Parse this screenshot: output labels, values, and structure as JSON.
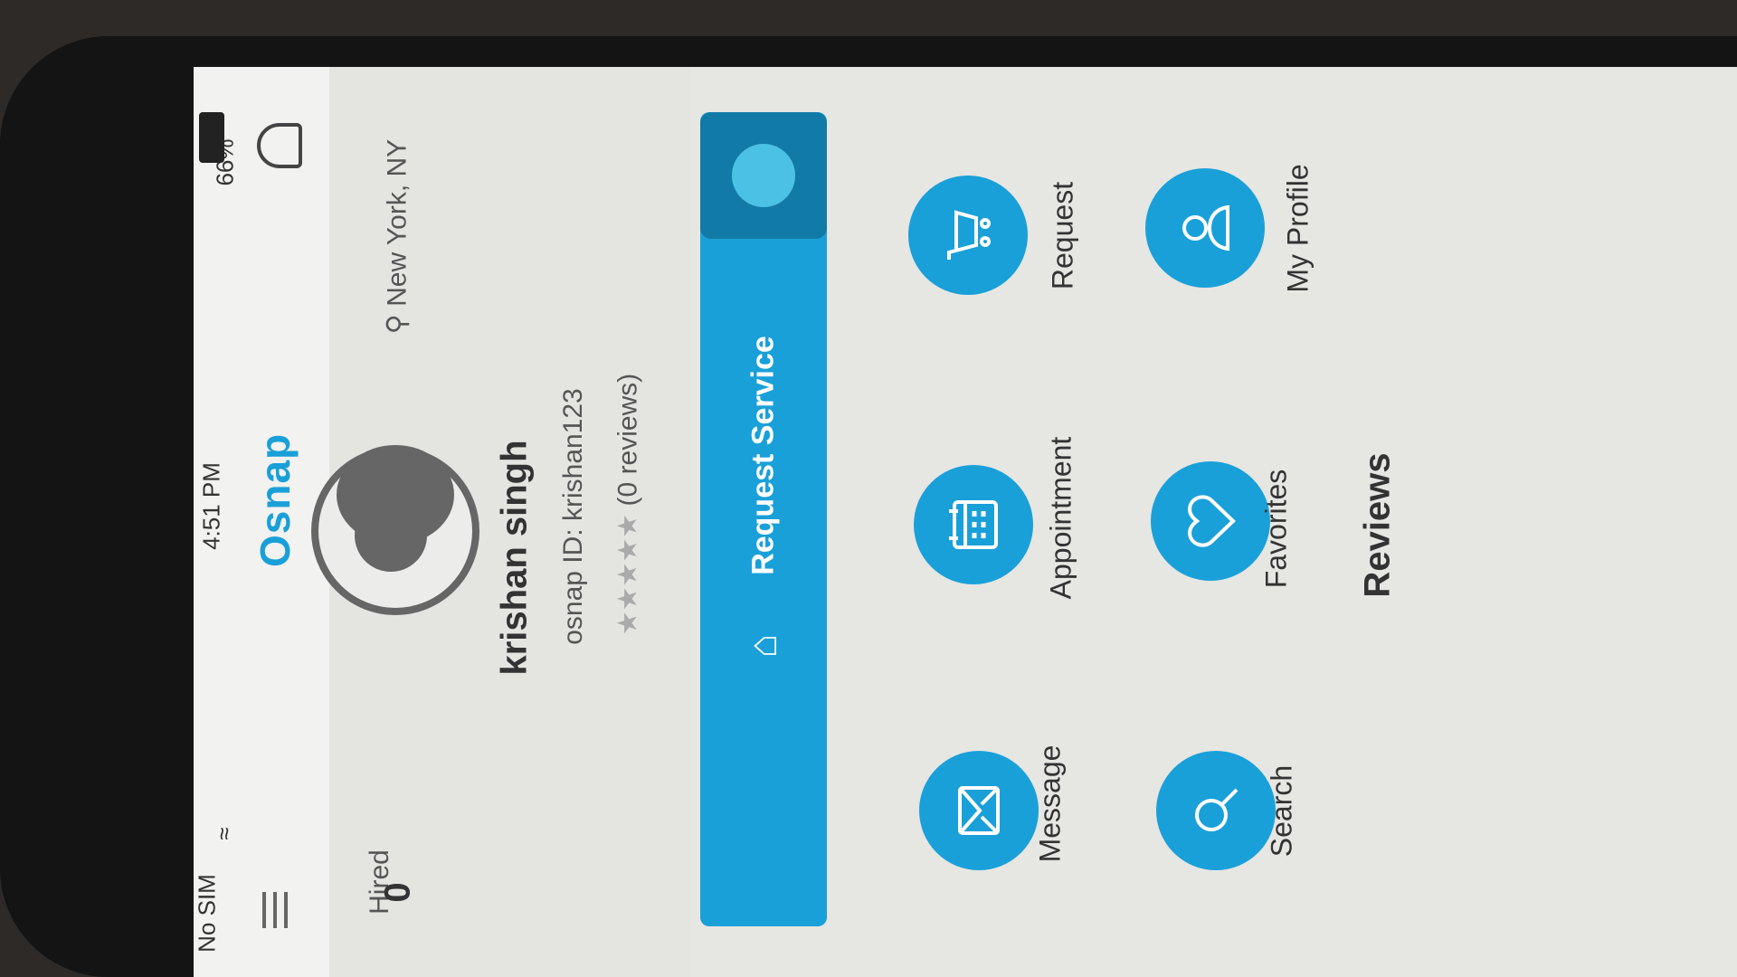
{
  "status_bar": {
    "carrier": "No SIM",
    "time": "4:51 PM",
    "battery": "66%"
  },
  "app": {
    "brand": "Osnap"
  },
  "profile": {
    "location": "New York, NY",
    "name": "krishan singh",
    "osnap_id": "osnap ID: krishan123",
    "reviews_count": "(0 reviews)",
    "rating_stars": 0,
    "hired_label": "Hired",
    "hired_value": "0"
  },
  "request_service": {
    "label": "Request Service"
  },
  "actions": [
    {
      "label": "Request",
      "icon": "cart-icon"
    },
    {
      "label": "My Profile",
      "icon": "profile-icon"
    },
    {
      "label": "Appointment",
      "icon": "calendar-icon"
    },
    {
      "label": "Favorites",
      "icon": "heart-icon"
    },
    {
      "label": "Message",
      "icon": "envelope-icon"
    },
    {
      "label": "Search",
      "icon": "search-icon"
    }
  ],
  "reviews_heading": "Reviews",
  "colors": {
    "accent": "#1aa0d9",
    "accent_dark": "#127aa6",
    "text": "#333333"
  }
}
